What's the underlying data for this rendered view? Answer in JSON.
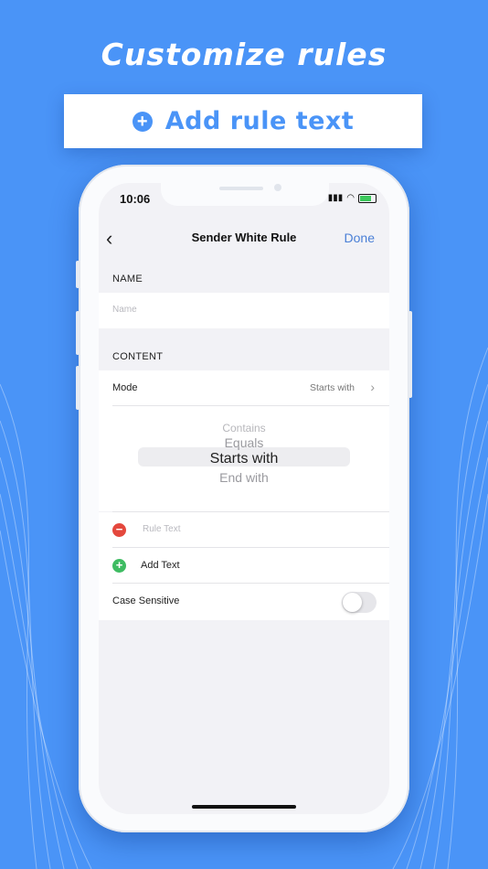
{
  "headline": "Customize rules",
  "banner": {
    "icon": "plus-circle-icon",
    "text": "Add rule text"
  },
  "status_bar": {
    "time": "10:06",
    "icons": [
      "signal-icon",
      "wifi-icon",
      "battery-icon"
    ]
  },
  "nav": {
    "back_icon": "chevron-left-icon",
    "title": "Sender White Rule",
    "done_label": "Done"
  },
  "name_section": {
    "header": "NAME",
    "placeholder": "Name"
  },
  "content_section": {
    "header": "CONTENT"
  },
  "mode_row": {
    "label": "Mode",
    "value": "Starts with"
  },
  "picker": {
    "options": [
      "Contains",
      "Equals",
      "Starts with",
      "End with"
    ],
    "selected": "Starts with"
  },
  "rule_text_row": {
    "placeholder": "Rule Text",
    "icon": "remove-circle-icon"
  },
  "add_text_row": {
    "label": "Add Text",
    "icon": "add-circle-icon"
  },
  "case_sensitive_row": {
    "label": "Case Sensitive",
    "enabled": false
  },
  "colors": {
    "background": "#4a94f7",
    "accent": "#4a7fd6",
    "remove": "#e4483d",
    "add": "#3ebc62"
  }
}
